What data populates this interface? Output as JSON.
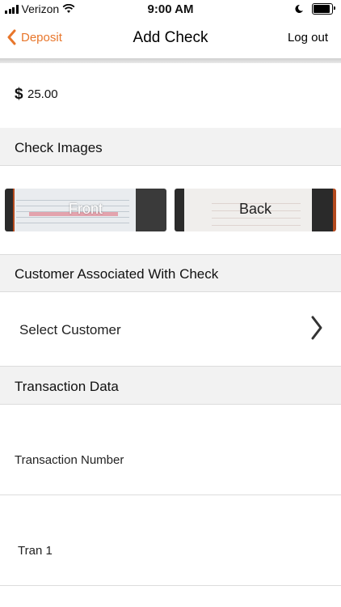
{
  "status_bar": {
    "carrier": "Verizon",
    "time": "9:00 AM",
    "battery_level": 0.9
  },
  "nav": {
    "back_label": "Deposit",
    "title": "Add Check",
    "action_label": "Log out"
  },
  "amount": {
    "currency_symbol": "$",
    "value": "25.00"
  },
  "sections": {
    "check_images": "Check Images",
    "customer": "Customer Associated With Check",
    "transaction": "Transaction Data"
  },
  "check_images": {
    "front_label": "Front",
    "back_label": "Back"
  },
  "customer": {
    "select_label": "Select Customer"
  },
  "transaction": {
    "number_field": "Transaction Number",
    "tran_field": "Tran 1"
  },
  "colors": {
    "accent": "#e8762b",
    "section_bg": "#f2f2f2",
    "divider": "#dcdcdc"
  },
  "icons": {
    "back": "chevron-left-icon",
    "disclosure": "chevron-right-icon",
    "signal": "cellular-signal-icon",
    "wifi": "wifi-icon",
    "dnd": "moon-icon",
    "battery": "battery-icon"
  }
}
